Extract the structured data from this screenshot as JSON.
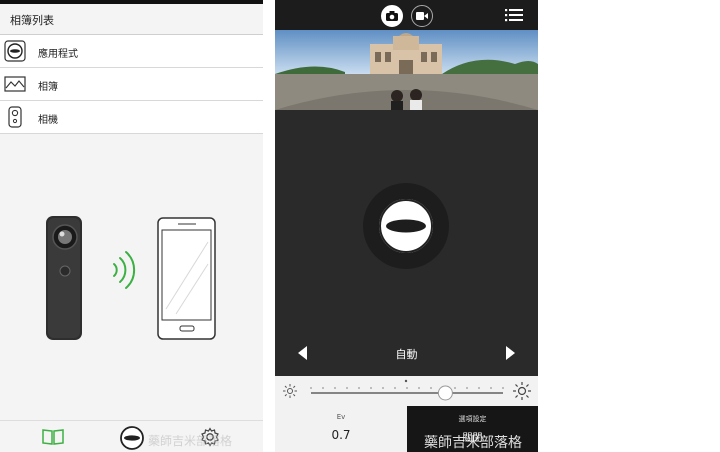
{
  "left": {
    "title": "相簿列表",
    "menu": [
      {
        "label": "應用程式",
        "icon": "camera-app-icon"
      },
      {
        "label": "相簿",
        "icon": "landscape-photo-icon"
      },
      {
        "label": "相機",
        "icon": "theta-camera-icon"
      }
    ],
    "bottom_nav": [
      "album-book-icon",
      "shutter-icon",
      "settings-gear-icon"
    ],
    "accent_color": "#3cb043"
  },
  "right": {
    "mode": "自動",
    "ev_caption": "Ev",
    "ev_value": "0.7",
    "options_caption": "選項設定",
    "options_value": "關閉",
    "ev_slider_level": 0.7,
    "active_mode": "photo"
  },
  "watermark": "藥師吉米部落格"
}
